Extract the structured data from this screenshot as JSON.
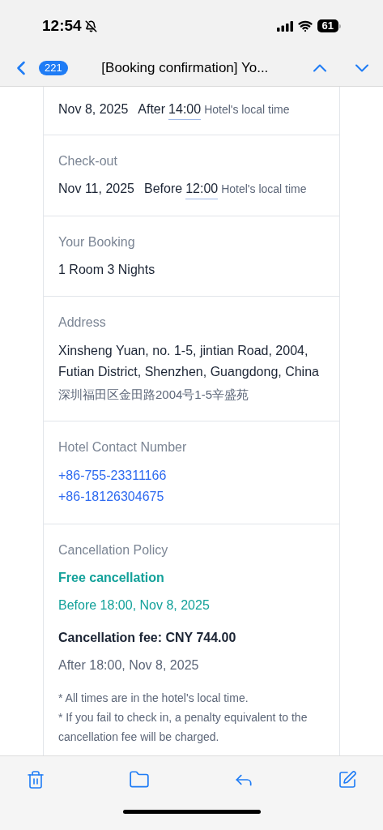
{
  "status_bar": {
    "time": "12:54",
    "battery": "61"
  },
  "nav": {
    "unread_count": "221",
    "title": "[Booking confirmation] Yo..."
  },
  "sections": [
    {
      "kind": "time",
      "date": "Nov 8, 2025",
      "prefix": "After",
      "time": "14:00",
      "note": "Hotel's local time"
    },
    {
      "kind": "time",
      "label": "Check-out",
      "date": "Nov 11, 2025",
      "prefix": "Before",
      "time": "12:00",
      "note": "Hotel's local time"
    },
    {
      "kind": "text",
      "label": "Your Booking",
      "lines": [
        "1 Room 3 Nights"
      ]
    },
    {
      "kind": "address",
      "label": "Address",
      "address": "Xinsheng Yuan, no. 1-5, jintian Road, 2004, Futian District, Shenzhen, Guangdong, China",
      "local": "深圳福田区金田路2004号1-5辛盛苑"
    },
    {
      "kind": "phones",
      "label": "Hotel Contact Number",
      "lines": [
        "+86-755-23311166",
        "+86-18126304675"
      ]
    },
    {
      "kind": "policy",
      "label": "Cancellation Policy",
      "free_title": "Free cancellation",
      "free_time": "Before 18:00, Nov 8, 2025",
      "fee_title": "Cancellation fee: CNY 744.00",
      "fee_time": "After 18:00, Nov 8, 2025",
      "notes": [
        "* All times are in the hotel's local time.",
        "* If you fail to check in, a penalty equivalent to the cancellation fee will be charged."
      ]
    }
  ]
}
